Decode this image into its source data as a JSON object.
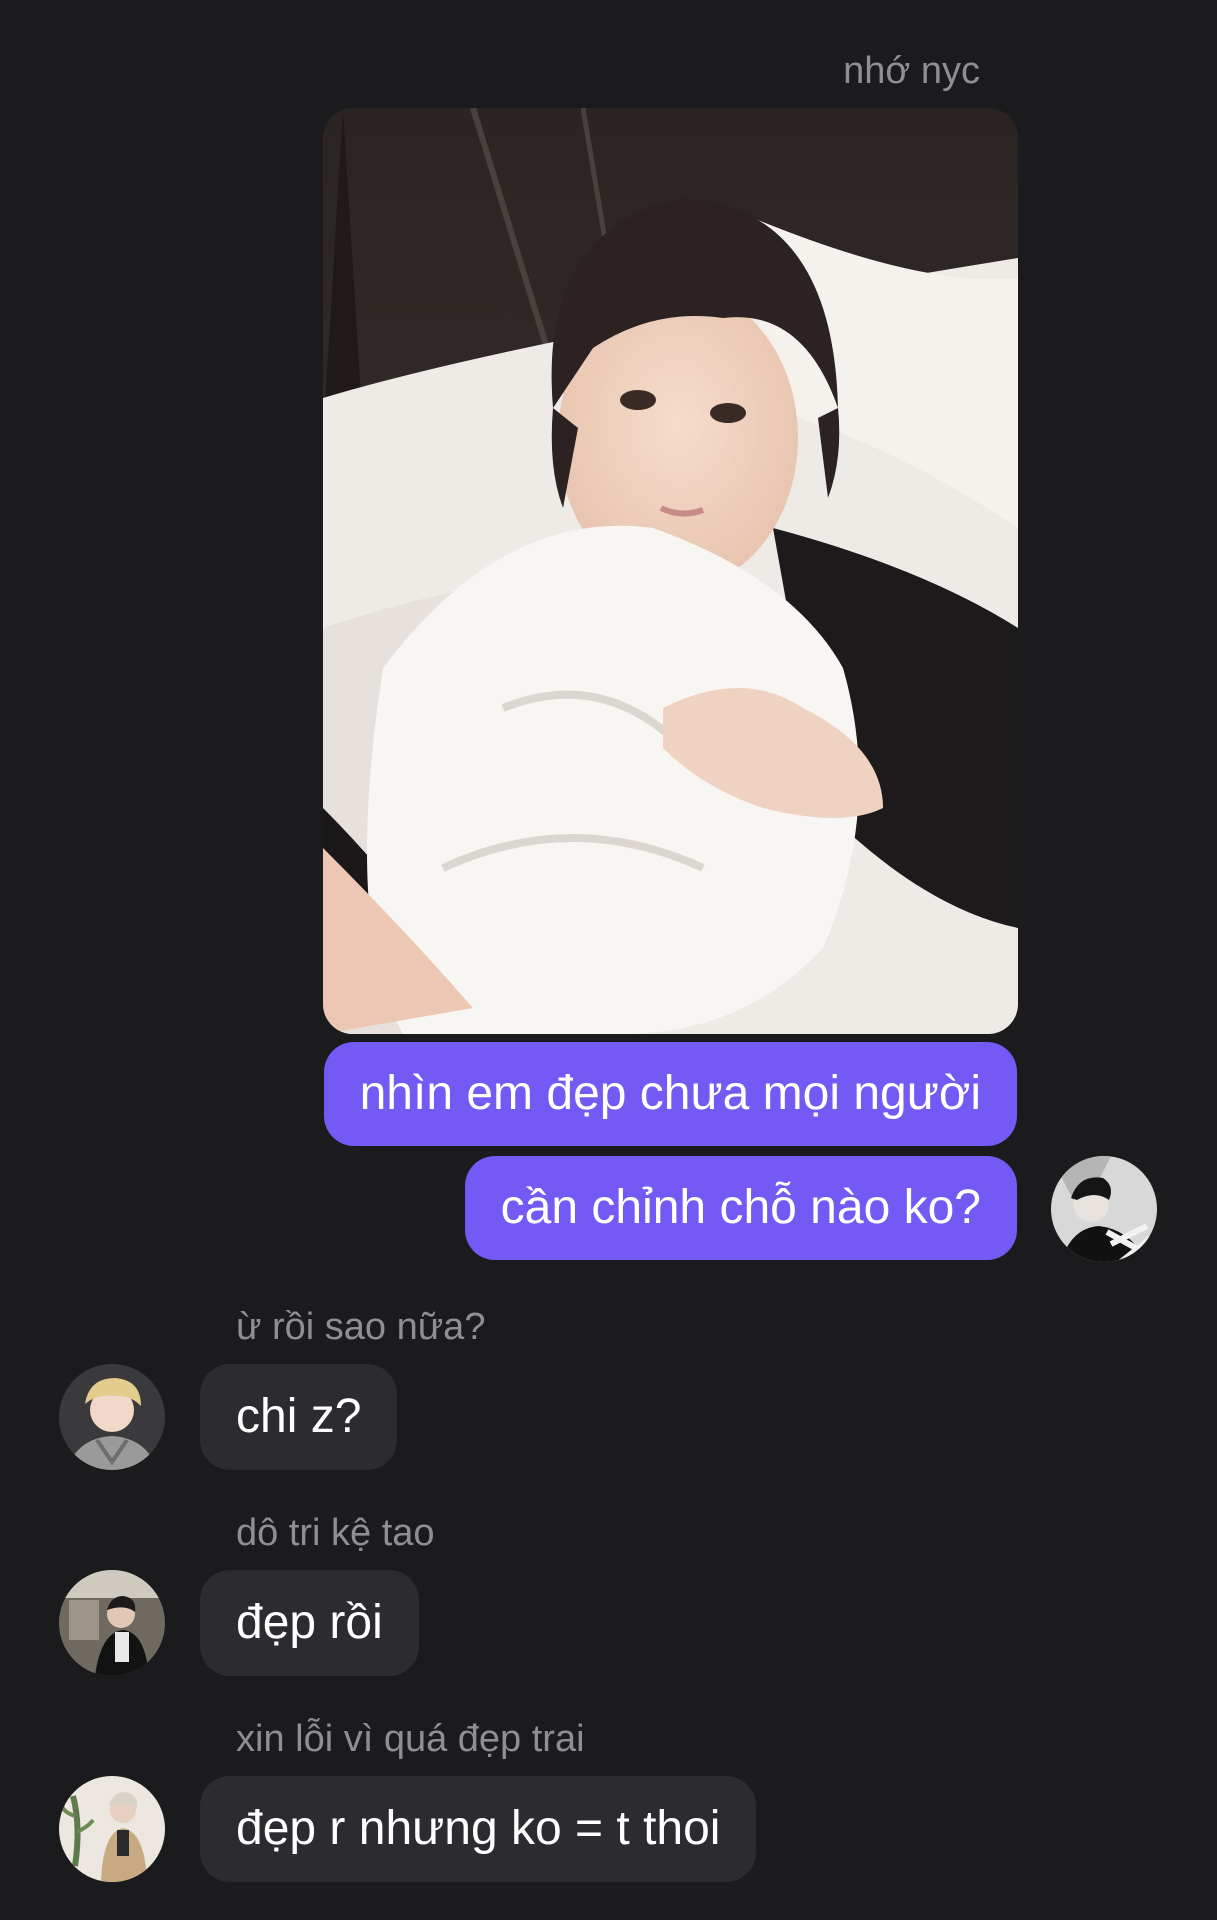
{
  "outgoing": {
    "sender_name": "nhớ nyc",
    "photo_icon": "selfie-photo",
    "messages": [
      "nhìn em đẹp chưa mọi người",
      "cần chỉnh chỗ nào ko?"
    ],
    "avatar_icon": "user-avatar-icon"
  },
  "incoming": [
    {
      "sender": "ừ rồi sao nữa?",
      "text": "chi z?"
    },
    {
      "sender": "dô tri kệ tao",
      "text": "đẹp rồi"
    },
    {
      "sender": "xin lỗi vì quá đẹp trai",
      "text": "đẹp r nhưng ko = t thoi"
    }
  ],
  "colors": {
    "background": "#1b1b1e",
    "outgoing_bubble": "#7559f4",
    "incoming_bubble": "#2c2c30",
    "sender_name": "#8e8e93"
  }
}
